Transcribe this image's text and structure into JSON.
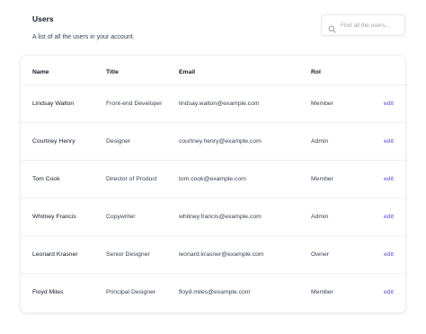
{
  "header": {
    "title": "Users",
    "subtitle": "A list of all the users in your account."
  },
  "search": {
    "placeholder": "Find all the users...",
    "value": "",
    "icon": "search-icon"
  },
  "table": {
    "columns": {
      "name": "Name",
      "title": "Title",
      "email": "Email",
      "role": "Rol"
    },
    "rows": [
      {
        "name": "Lindsay Walton",
        "title": "Front-end Developer",
        "email": "lindsay.walton@example.com",
        "role": "Member",
        "action": "edit"
      },
      {
        "name": "Courtney Henry",
        "title": "Designer",
        "email": "courtney.henry@example.com",
        "role": "Admin",
        "action": "edit"
      },
      {
        "name": "Tom Cook",
        "title": "Director of Product",
        "email": "tom.cook@example.com",
        "role": "Member",
        "action": "edit"
      },
      {
        "name": "Whitney Francis",
        "title": "Copywriter",
        "email": "whitney.francis@example.com",
        "role": "Admin",
        "action": "edit"
      },
      {
        "name": "Leonard Krasner",
        "title": "Senior Designer",
        "email": "leonard.krasner@example.com",
        "role": "Owner",
        "action": "edit"
      },
      {
        "name": "Floyd Miles",
        "title": "Principal Designer",
        "email": "floyd.miles@example.com",
        "role": "Member",
        "action": "edit"
      }
    ]
  },
  "colors": {
    "accent": "#4f46e5",
    "text": "#111827",
    "muted": "#374151",
    "border": "#e5e7eb"
  }
}
